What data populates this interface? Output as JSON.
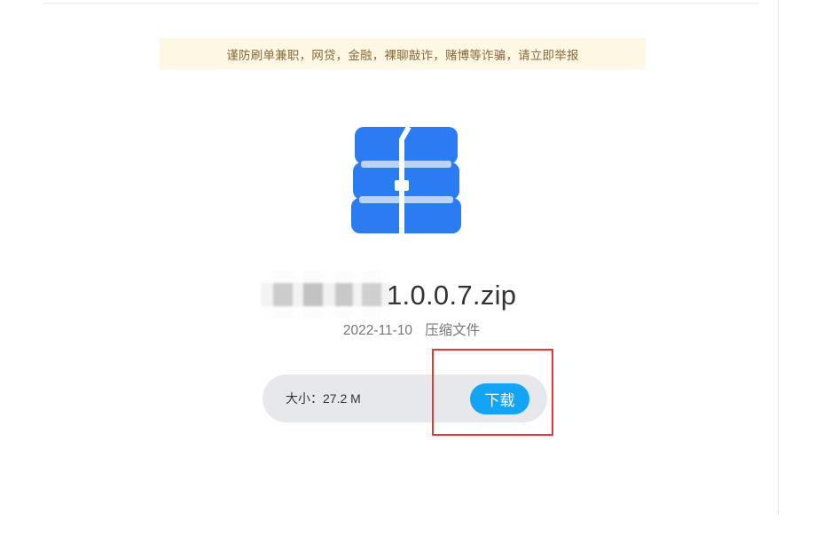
{
  "notice": {
    "text": "谨防刷单兼职，网贷，金融，裸聊敲诈，赌博等诈骗，请立即举报"
  },
  "file": {
    "icon": "archive-zip-icon",
    "name_suffix": "1.0.0.7.zip",
    "date": "2022-11-10",
    "type": "压缩文件"
  },
  "size": {
    "label": "大小：27.2 M"
  },
  "actions": {
    "download_label": "下载"
  },
  "colors": {
    "icon_blue": "#2b7cf2",
    "band_light": "#bcd3f7",
    "button_blue": "#14a4f5",
    "notice_bg": "#fdf7e3",
    "notice_text": "#8a6a3b",
    "highlight_red": "#e53935",
    "size_bar_bg": "#e6e8eb"
  }
}
